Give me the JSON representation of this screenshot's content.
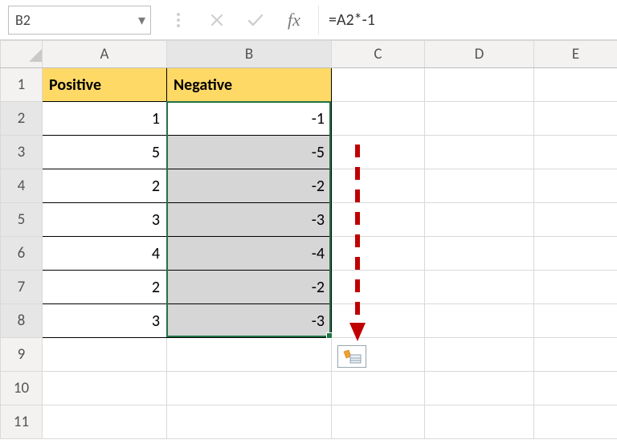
{
  "formula_bar": {
    "name_box": "B2",
    "formula": "=A2*-1"
  },
  "columns": [
    "A",
    "B",
    "C",
    "D",
    "E"
  ],
  "rows": [
    "1",
    "2",
    "3",
    "4",
    "5",
    "6",
    "7",
    "8",
    "9",
    "10",
    "11"
  ],
  "headers": {
    "a": "Positive",
    "b": "Negative"
  },
  "data": {
    "positive": [
      1,
      5,
      2,
      3,
      4,
      2,
      3
    ],
    "negative": [
      -1,
      -5,
      -2,
      -3,
      -4,
      -2,
      -3
    ]
  },
  "icons": {
    "cancel": "✕",
    "confirm": "✓",
    "fx": "fx",
    "caret": "▾"
  },
  "selection": {
    "active_cell": "B2",
    "range": "B2:B8"
  },
  "chart_data": {
    "type": "table",
    "title": "",
    "columns": [
      "Positive",
      "Negative"
    ],
    "rows": [
      [
        1,
        -1
      ],
      [
        5,
        -5
      ],
      [
        2,
        -2
      ],
      [
        3,
        -3
      ],
      [
        4,
        -4
      ],
      [
        2,
        -2
      ],
      [
        3,
        -3
      ]
    ]
  }
}
